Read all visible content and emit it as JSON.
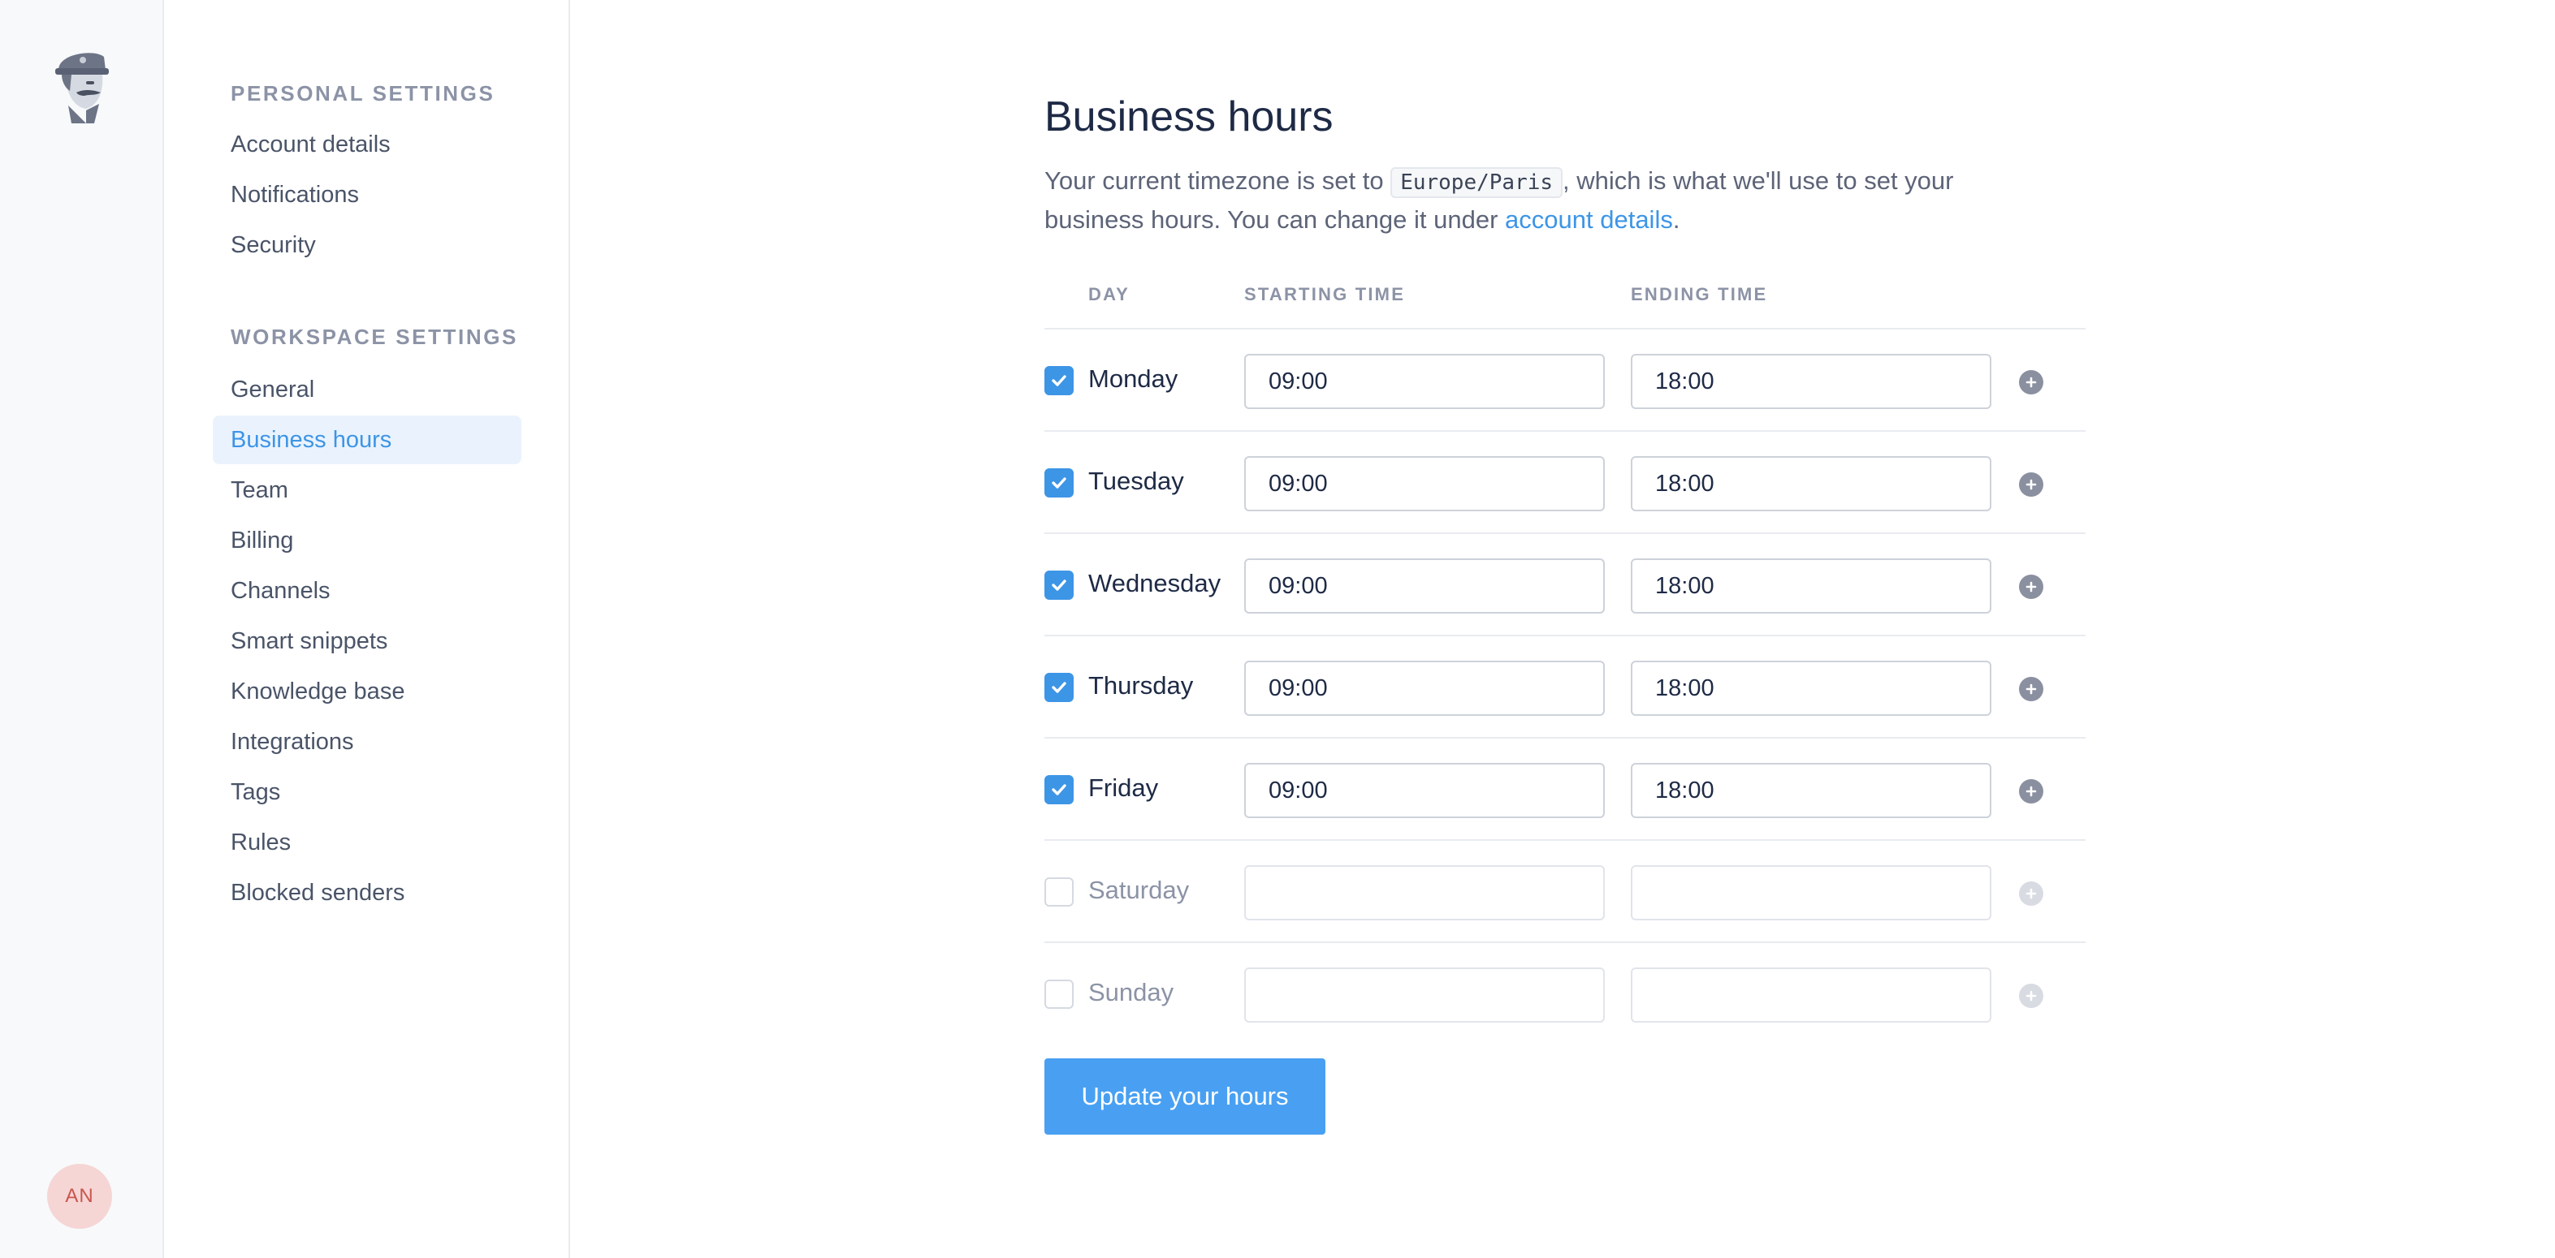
{
  "rail": {
    "logo_icon": "agent-mascot-logo",
    "avatar_initials": "AN",
    "avatar_bg": "#f6d5d5",
    "avatar_fg": "#c9564d"
  },
  "nav": {
    "personal_heading": "PERSONAL SETTINGS",
    "personal_items": [
      "Account details",
      "Notifications",
      "Security"
    ],
    "workspace_heading": "WORKSPACE SETTINGS",
    "workspace_items": [
      "General",
      "Business hours",
      "Team",
      "Billing",
      "Channels",
      "Smart snippets",
      "Knowledge base",
      "Integrations",
      "Tags",
      "Rules",
      "Blocked senders"
    ],
    "active_item": "Business hours"
  },
  "page": {
    "title": "Business hours",
    "intro_before": "Your current timezone is set to ",
    "timezone": "Europe/Paris",
    "intro_middle": ", which is what we'll use to set your business hours. You can change it under ",
    "intro_link": "account details",
    "intro_after": "."
  },
  "table": {
    "col_day": "DAY",
    "col_start": "STARTING TIME",
    "col_end": "ENDING TIME",
    "rows": [
      {
        "day": "Monday",
        "enabled": true,
        "start": "09:00",
        "end": "18:00"
      },
      {
        "day": "Tuesday",
        "enabled": true,
        "start": "09:00",
        "end": "18:00"
      },
      {
        "day": "Wednesday",
        "enabled": true,
        "start": "09:00",
        "end": "18:00"
      },
      {
        "day": "Thursday",
        "enabled": true,
        "start": "09:00",
        "end": "18:00"
      },
      {
        "day": "Friday",
        "enabled": true,
        "start": "09:00",
        "end": "18:00"
      },
      {
        "day": "Saturday",
        "enabled": false,
        "start": "",
        "end": ""
      },
      {
        "day": "Sunday",
        "enabled": false,
        "start": "",
        "end": ""
      }
    ]
  },
  "submit_label": "Update your hours",
  "colors": {
    "accent": "#3d95e6",
    "button": "#49a0f2",
    "active_nav_bg": "#eaf3fd"
  }
}
